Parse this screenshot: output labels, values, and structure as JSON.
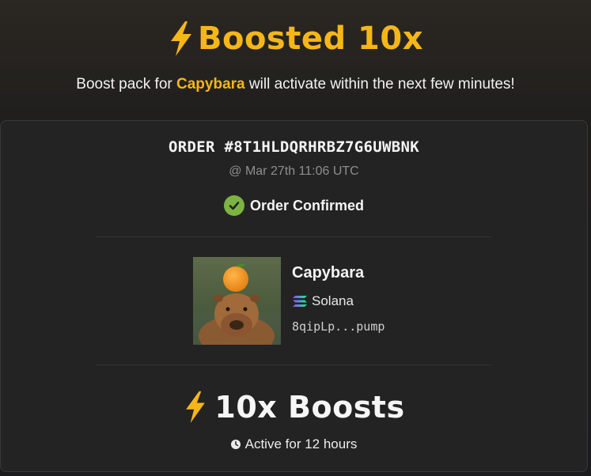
{
  "header": {
    "title": "Boosted 10x",
    "subtitle_pre": "Boost pack for ",
    "subtitle_token": "Capybara",
    "subtitle_post": " will activate within the next few minutes!"
  },
  "order": {
    "id_label": "ORDER #8T1HLDQRHRBZ7G6UWBNK",
    "timestamp": "@ Mar 27th 11:06 UTC",
    "status": "Order Confirmed"
  },
  "token": {
    "name": "Capybara",
    "chain": "Solana",
    "address": "8qipLp...pump"
  },
  "boost": {
    "title": "10x Boosts",
    "duration": "Active for 12 hours"
  },
  "colors": {
    "accent": "#f5b619",
    "success": "#7cb342",
    "card_bg": "#232324",
    "muted_text": "#8e8e90"
  },
  "icons": {
    "title_icon": "lightning-bolt-icon",
    "status_icon": "check-circle-icon",
    "chain_icon": "solana-icon",
    "duration_icon": "clock-icon"
  }
}
